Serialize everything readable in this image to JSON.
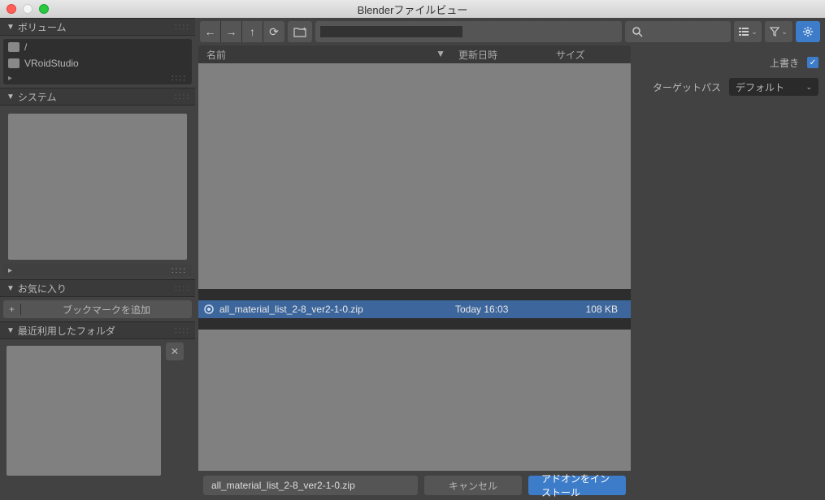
{
  "window": {
    "title": "Blenderファイルビュー"
  },
  "sidebar": {
    "volumes": {
      "title": "ボリューム",
      "items": [
        {
          "label": "/"
        },
        {
          "label": "VRoidStudio"
        }
      ]
    },
    "system": {
      "title": "システム"
    },
    "favorites": {
      "title": "お気に入り",
      "add_bookmark": "ブックマークを追加"
    },
    "recent": {
      "title": "最近利用したフォルダ"
    }
  },
  "toolbar": {
    "search_placeholder": ""
  },
  "columns": {
    "name": "名前",
    "date": "更新日時",
    "size": "サイズ"
  },
  "files": {
    "selected": {
      "name": "all_material_list_2-8_ver2-1-0.zip",
      "date": "Today 16:03",
      "size": "108 KB"
    }
  },
  "props": {
    "overwrite_label": "上書き",
    "overwrite_checked": true,
    "target_path_label": "ターゲットパス",
    "target_path_value": "デフォルト"
  },
  "footer": {
    "filename": "all_material_list_2-8_ver2-1-0.zip",
    "cancel": "キャンセル",
    "install": "アドオンをインストール"
  }
}
